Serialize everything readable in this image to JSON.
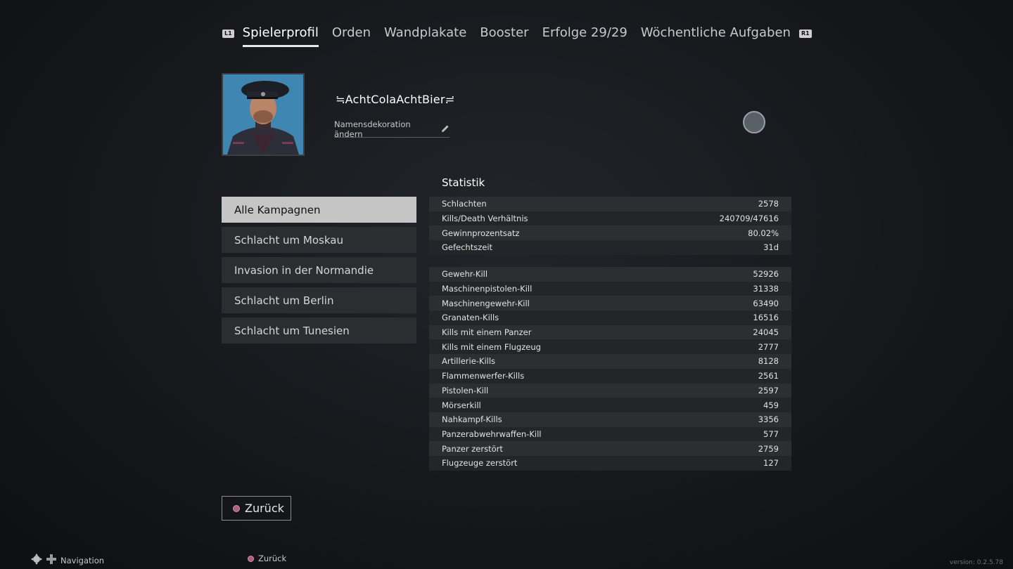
{
  "nav": {
    "left_hint": "L1",
    "right_hint": "R1",
    "tabs": [
      {
        "label": "Spielerprofil",
        "active": true
      },
      {
        "label": "Orden"
      },
      {
        "label": "Wandplakate"
      },
      {
        "label": "Booster"
      },
      {
        "label": "Erfolge 29/29"
      },
      {
        "label": "Wöchentliche Aufgaben"
      }
    ]
  },
  "profile": {
    "name": "≒AchtColaAchtBier≓",
    "decoration_label": "Namensdekoration ändern"
  },
  "campaigns": [
    {
      "label": "Alle Kampagnen",
      "active": true
    },
    {
      "label": "Schlacht um Moskau"
    },
    {
      "label": "Invasion in der Normandie"
    },
    {
      "label": "Schlacht um Berlin"
    },
    {
      "label": "Schlacht um Tunesien"
    }
  ],
  "stats": {
    "title": "Statistik",
    "general": [
      {
        "label": "Schlachten",
        "value": "2578"
      },
      {
        "label": "Kills/Death Verhältnis",
        "value": "240709/47616"
      },
      {
        "label": "Gewinnprozentsatz",
        "value": "80.02%"
      },
      {
        "label": "Gefechtszeit",
        "value": "31d"
      }
    ],
    "kills": [
      {
        "label": "Gewehr-Kill",
        "value": "52926"
      },
      {
        "label": "Maschinenpistolen-Kill",
        "value": "31338"
      },
      {
        "label": "Maschinengewehr-Kill",
        "value": "63490"
      },
      {
        "label": "Granaten-Kills",
        "value": "16516"
      },
      {
        "label": "Kills mit einem Panzer",
        "value": "24045"
      },
      {
        "label": "Kills mit einem Flugzeug",
        "value": "2777"
      },
      {
        "label": "Artillerie-Kills",
        "value": "8128"
      },
      {
        "label": "Flammenwerfer-Kills",
        "value": "2561"
      },
      {
        "label": "Pistolen-Kill",
        "value": "2597"
      },
      {
        "label": "Mörserkill",
        "value": "459"
      },
      {
        "label": "Nahkampf-Kills",
        "value": "3356"
      },
      {
        "label": "Panzerabwehrwaffen-Kill",
        "value": "577"
      },
      {
        "label": "Panzer zerstört",
        "value": "2759"
      },
      {
        "label": "Flugzeuge zerstört",
        "value": "127"
      }
    ]
  },
  "back_button": "Zurück",
  "footer": {
    "navigation": "Navigation",
    "back": "Zurück",
    "version": "version: 0.2.5.78"
  },
  "colors": {
    "accent_circle": "#b05e7e",
    "active_item_bg": "#c5c5c5"
  }
}
